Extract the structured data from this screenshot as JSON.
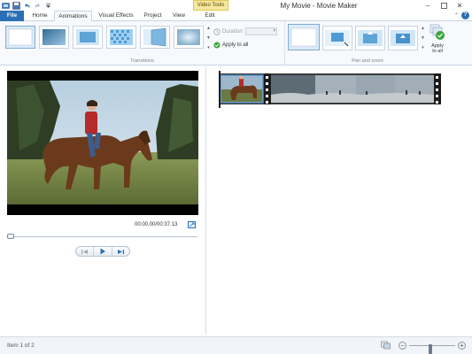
{
  "window": {
    "title": "My Movie - Movie Maker",
    "contextual_tab_group": "Video Tools"
  },
  "tabs": [
    {
      "label": "File"
    },
    {
      "label": "Home"
    },
    {
      "label": "Animations"
    },
    {
      "label": "Visual Effects"
    },
    {
      "label": "Project"
    },
    {
      "label": "View"
    },
    {
      "label": "Edit"
    }
  ],
  "ribbon": {
    "transitions": {
      "group_label": "Transitions",
      "duration_label": "Duration:",
      "duration_value": "",
      "apply_all_label": "Apply to all"
    },
    "pan_zoom": {
      "group_label": "Pan and zoom",
      "apply_label_line1": "Apply",
      "apply_label_line2": "to all"
    }
  },
  "preview": {
    "timecode": "00:00.00/00:37.13",
    "seek_progress": 0
  },
  "status": {
    "item_text": "Item 1 of 2",
    "zoom_level": 0.45
  },
  "colors": {
    "file_tab": "#2b6fb6",
    "ribbon_bg": "#f7f9fc",
    "contextual_tab": "#f5e7a0"
  }
}
